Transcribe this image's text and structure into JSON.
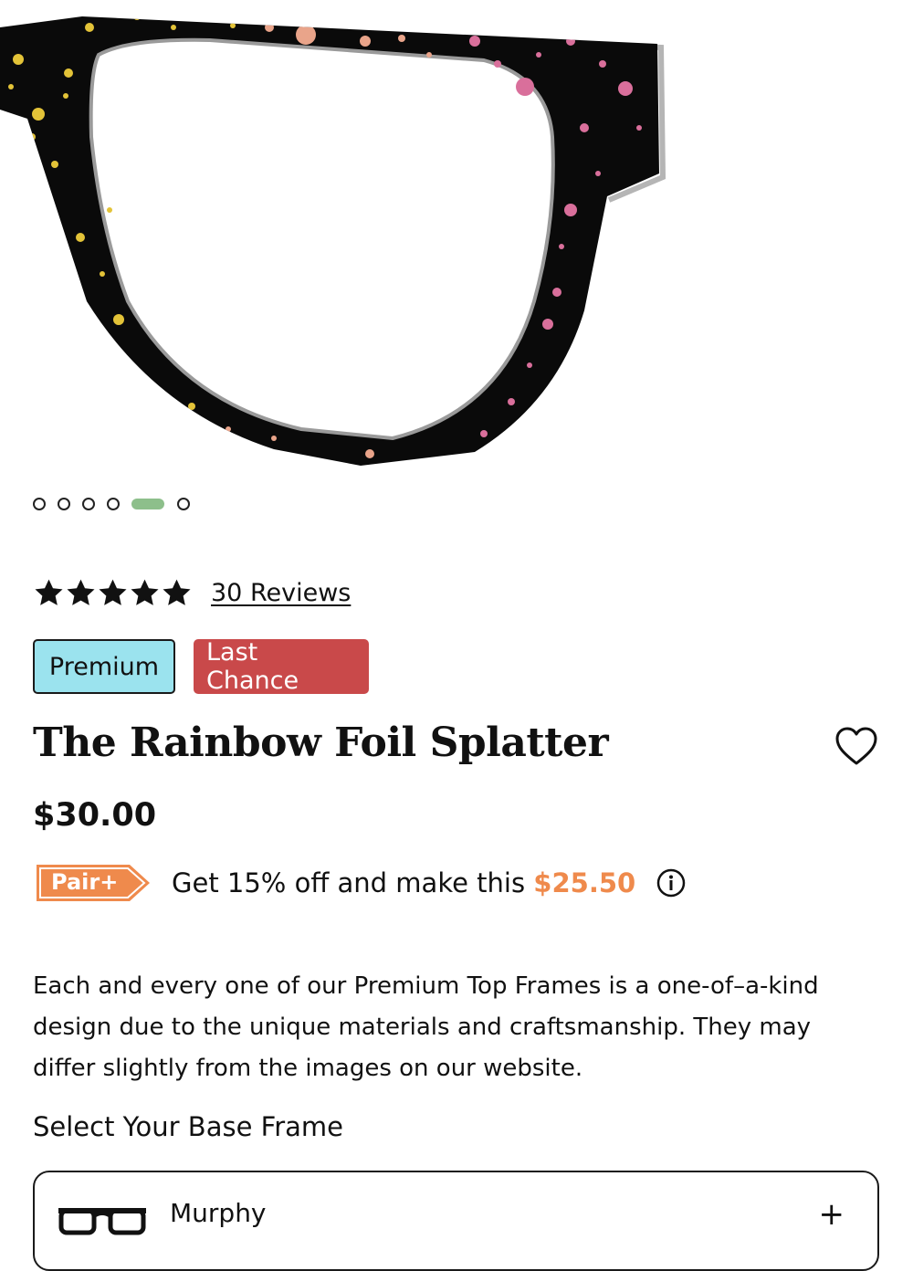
{
  "product": {
    "image_alt": "Black glasses frame with rainbow foil splatter",
    "carousel": {
      "total": 6,
      "active_index": 4
    },
    "rating": {
      "stars": 5,
      "reviews_label": "30 Reviews"
    },
    "badges": {
      "premium": "Premium",
      "last_chance": "Last Chance"
    },
    "title": "The Rainbow Foil Splatter",
    "price": "$30.00",
    "pair_plus": {
      "tag": "Pair+",
      "text_prefix": "Get 15% off and make this",
      "discount_price": "$25.50"
    },
    "description": "Each and every one of our Premium Top Frames is a one-of–a-kind design due to the unique materials and craftsmanship. They may differ slightly from the images on our website.",
    "base_frame": {
      "label": "Select Your Base Frame",
      "selected_name": "Murphy",
      "expand_symbol": "+"
    }
  },
  "colors": {
    "premium_badge": "#9be3ee",
    "last_chance_badge": "#c9494a",
    "pair_plus_accent": "#ef8a4c",
    "carousel_active": "#8dbf8b"
  },
  "icons": {
    "favorite": "heart-outline-icon",
    "info": "info-circle-icon",
    "rating": "star-icon",
    "frame": "glasses-icon"
  }
}
